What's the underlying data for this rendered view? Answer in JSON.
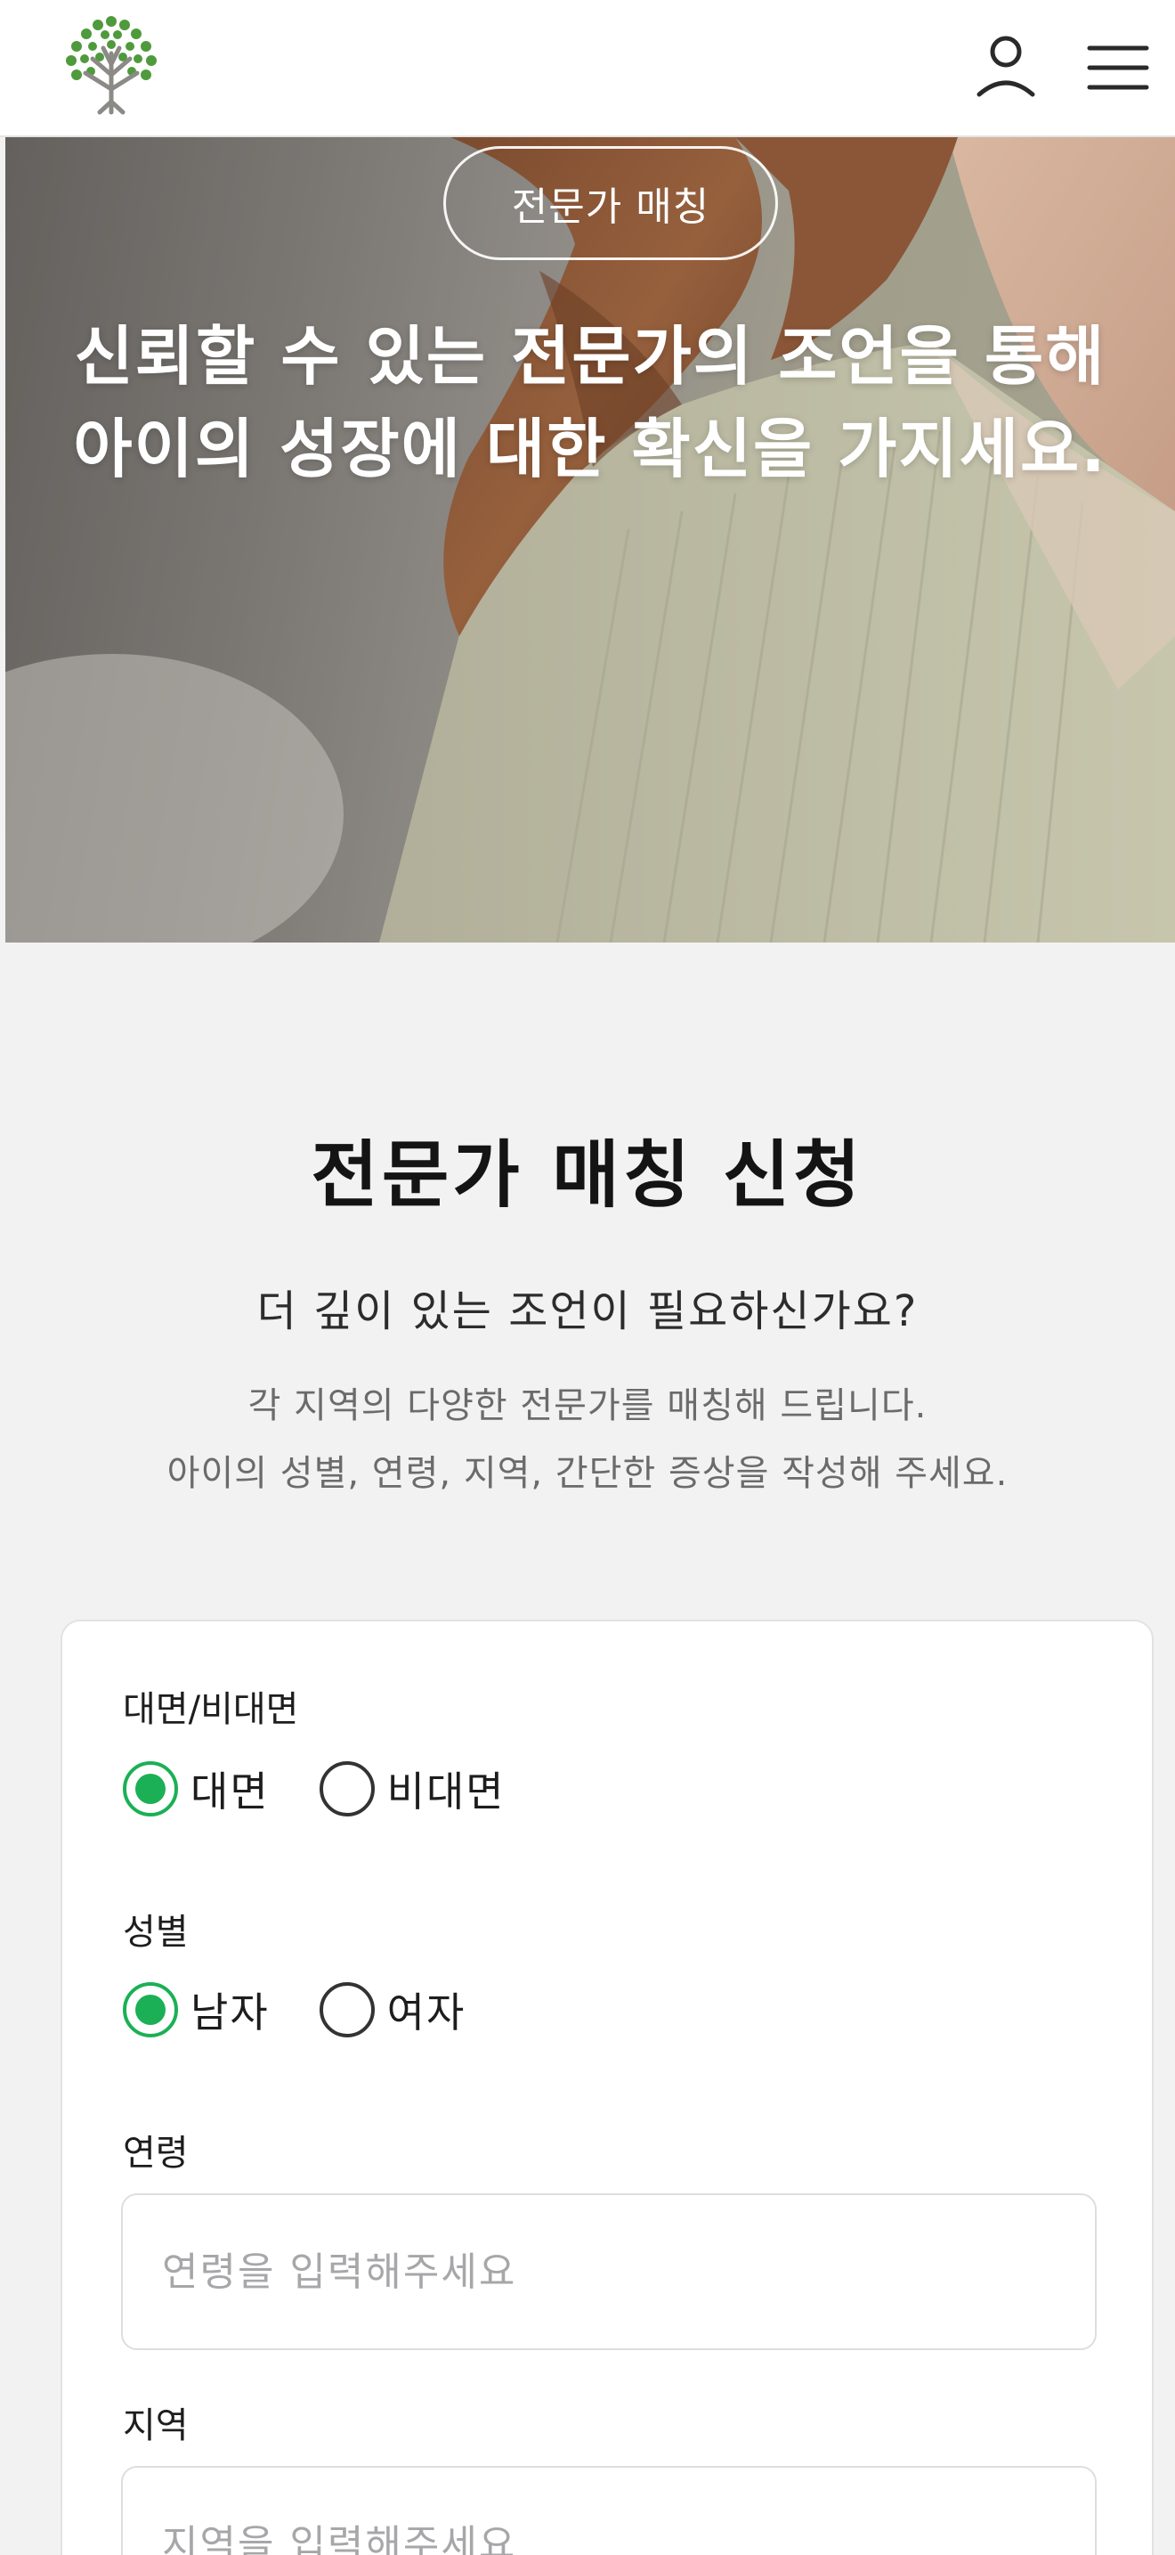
{
  "header": {
    "logo_icon": "tree-logo-icon",
    "user_icon": "user-icon",
    "menu_icon": "hamburger-menu-icon"
  },
  "hero": {
    "badge": "전문가 매칭",
    "title": "신뢰할 수 있는 전문가의 조언을 통해 아이의 성장에 대한 확신을 가지세요."
  },
  "intro": {
    "title": "전문가 매칭 신청",
    "subtitle": "더 깊이 있는 조언이 필요하신가요?",
    "description_line1": "각 지역의 다양한 전문가를 매칭해 드립니다.",
    "description_line2": "아이의 성별, 연령, 지역, 간단한 증상을 작성해 주세요."
  },
  "form": {
    "meeting_type": {
      "label": "대면/비대면",
      "options": [
        "대면",
        "비대면"
      ],
      "selected": "대면"
    },
    "gender": {
      "label": "성별",
      "options": [
        "남자",
        "여자"
      ],
      "selected": "남자"
    },
    "age": {
      "label": "연령",
      "value": "",
      "placeholder": "연령을 입력해주세요"
    },
    "region": {
      "label": "지역",
      "value": "",
      "placeholder": "지역을 입력해주세요"
    }
  },
  "colors": {
    "accent": "#1bb055",
    "logo_green": "#4f9a3c"
  }
}
